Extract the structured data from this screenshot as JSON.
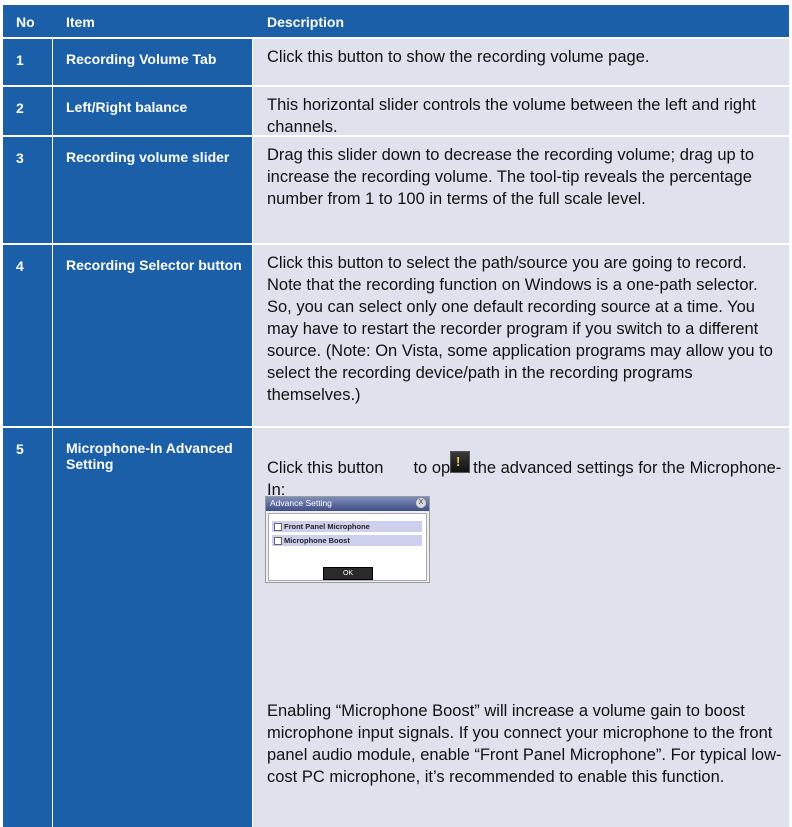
{
  "header": {
    "no": "No",
    "item": "Item",
    "description": "Description"
  },
  "rows": [
    {
      "no": "1",
      "item": "Recording Volume Tab",
      "description": "Click this button to show the recording volume page."
    },
    {
      "no": "2",
      "item": "Left/Right balance",
      "description": "This horizontal slider controls the volume between the left and right channels."
    },
    {
      "no": "3",
      "item": "Recording volume slider",
      "description": "Drag this slider down to decrease the recording volume; drag up to increase the recording volume. The tool-tip reveals the percentage number from 1 to 100 in terms of the full scale level."
    },
    {
      "no": "4",
      "item": "Recording Selector button",
      "description": "Click this button to select the path/source you are going to record. Note that the recording function on Windows is a one-path selector. So, you can select only one default recording source at a time. You may have to restart the recorder program if you switch to a different source. (Note: On Vista, some application programs may allow you to select the recording device/path in the recording programs themselves.)"
    },
    {
      "no": "5",
      "item": "Microphone-In Advanced Setting",
      "description_before": "Click this button",
      "description_after": "to open the advanced settings for the Microphone-In:",
      "description_more": "Enabling “Microphone Boost” will increase a volume gain to boost microphone input signals. If you connect your microphone to the front panel audio module, enable “Front Panel Microphone”. For typical low-cost PC microphone, it’s recommended to enable this function."
    }
  ],
  "dialog": {
    "title": "Advance Setting",
    "close": "X",
    "options": [
      "Front Panel Microphone",
      "Microphone Boost"
    ],
    "ok": "OK"
  },
  "colors": {
    "header_bg": "#1a5fa8",
    "desc_bg": "#dfe1ec"
  }
}
